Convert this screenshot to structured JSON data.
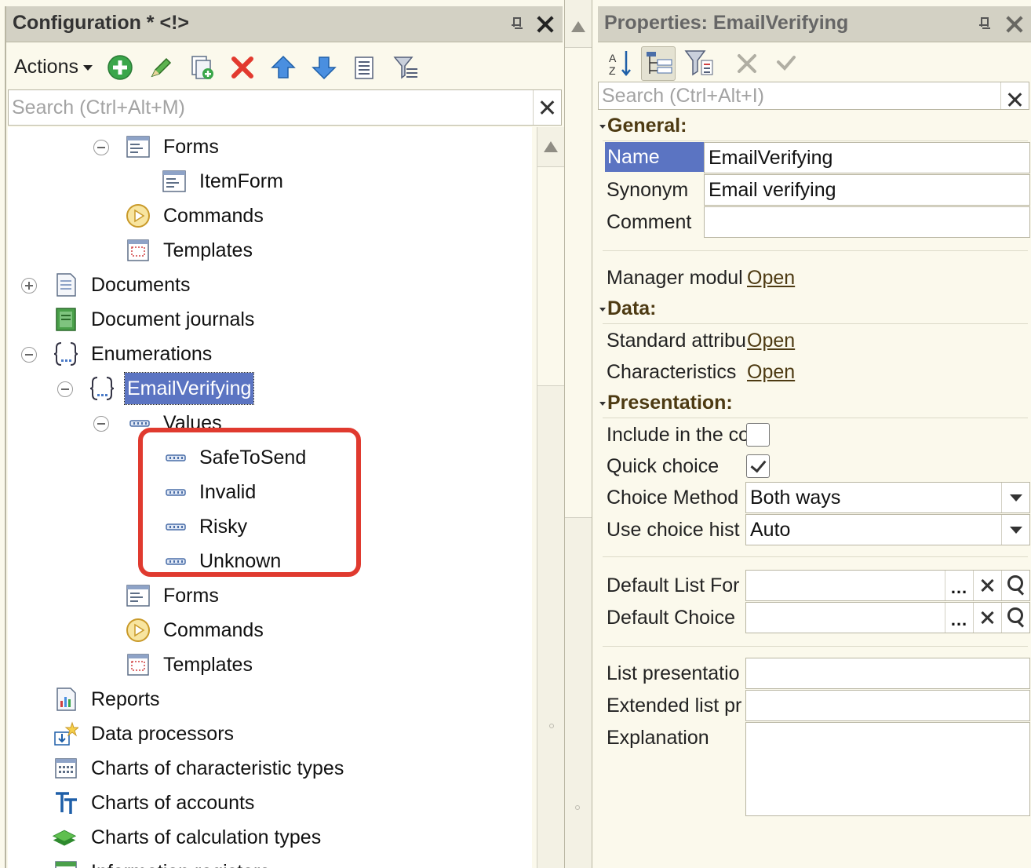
{
  "left": {
    "title": "Configuration * <!>",
    "actions_label": "Actions",
    "search_placeholder": "Search (Ctrl+Alt+M)",
    "tree": [
      {
        "label": "Forms"
      },
      {
        "label": "ItemForm"
      },
      {
        "label": "Commands"
      },
      {
        "label": "Templates"
      },
      {
        "label": "Documents"
      },
      {
        "label": "Document journals"
      },
      {
        "label": "Enumerations"
      },
      {
        "label": "EmailVerifying"
      },
      {
        "label": "Values"
      },
      {
        "label": "SafeToSend"
      },
      {
        "label": "Invalid"
      },
      {
        "label": "Risky"
      },
      {
        "label": "Unknown"
      },
      {
        "label": "Forms"
      },
      {
        "label": "Commands"
      },
      {
        "label": "Templates"
      },
      {
        "label": "Reports"
      },
      {
        "label": "Data processors"
      },
      {
        "label": "Charts of characteristic types"
      },
      {
        "label": "Charts of accounts"
      },
      {
        "label": "Charts of calculation types"
      },
      {
        "label": "Information registers"
      }
    ]
  },
  "right": {
    "title": "Properties: EmailVerifying",
    "search_placeholder": "Search (Ctrl+Alt+I)",
    "sections": {
      "general": "General:",
      "data": "Data:",
      "presentation": "Presentation:"
    },
    "props": {
      "name_label": "Name",
      "name_value": "EmailVerifying",
      "synonym_label": "Synonym",
      "synonym_value": "Email verifying",
      "comment_label": "Comment",
      "comment_value": "",
      "manager_module_label": "Manager modul",
      "standard_attr_label": "Standard attribu",
      "characteristics_label": "Characteristics",
      "open_link": "Open",
      "include_label": "Include in the co",
      "quick_choice_label": "Quick choice",
      "choice_method_label": "Choice Method",
      "choice_method_value": "Both ways",
      "use_choice_history_label": "Use choice hist",
      "use_choice_history_value": "Auto",
      "default_list_form_label": "Default List For",
      "default_choice_label": "Default Choice",
      "list_presentation_label": "List presentatio",
      "extended_list_label": "Extended list pr",
      "explanation_label": "Explanation",
      "dots": "..."
    },
    "checkboxes": {
      "include_in_command_interface": false,
      "quick_choice": true
    }
  },
  "colors": {
    "selection": "#5b74c2",
    "highlight_box": "#e03a2f",
    "panel_bg": "#fbf9ec",
    "titlebar_bg": "#d3d1c4",
    "section_text": "#4d3a12"
  },
  "icons": [
    "add-icon",
    "edit-icon",
    "copy-icon",
    "delete-icon",
    "move-up-icon",
    "move-down-icon",
    "list-icon",
    "filter-icon",
    "sort-az-icon",
    "tree-view-icon",
    "filter-properties-icon",
    "cancel-icon",
    "confirm-icon"
  ]
}
